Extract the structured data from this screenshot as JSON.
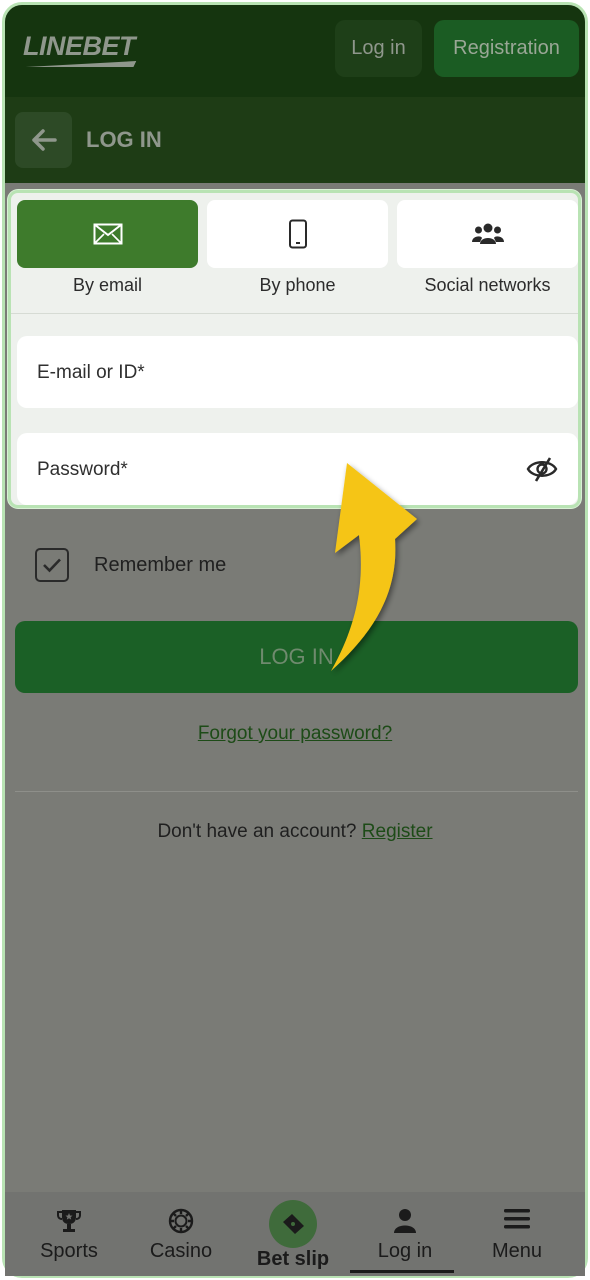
{
  "header": {
    "logo_text": "LINEBET",
    "login_label": "Log in",
    "registration_label": "Registration"
  },
  "page": {
    "title": "LOG IN"
  },
  "tabs": [
    {
      "label": "By email",
      "icon": "envelope-icon",
      "active": true
    },
    {
      "label": "By phone",
      "icon": "phone-icon",
      "active": false
    },
    {
      "label": "Social networks",
      "icon": "people-icon",
      "active": false
    }
  ],
  "form": {
    "email_label": "E-mail or ID*",
    "password_label": "Password*",
    "remember_label": "Remember me",
    "remember_checked": true,
    "login_button": "LOG IN",
    "forgot_link": "Forgot your password?",
    "no_account_text": "Don't have an account?",
    "register_link": "Register"
  },
  "bottom_nav": [
    {
      "label": "Sports",
      "icon": "trophy-icon"
    },
    {
      "label": "Casino",
      "icon": "casino-chip-icon"
    },
    {
      "label": "Bet slip",
      "icon": "ticket-icon"
    },
    {
      "label": "Log in",
      "icon": "user-icon"
    },
    {
      "label": "Menu",
      "icon": "hamburger-icon"
    }
  ],
  "colors": {
    "accent_green": "#3e7b2c",
    "highlight_border": "#b9e3b4",
    "arrow_yellow": "#f5c518"
  }
}
